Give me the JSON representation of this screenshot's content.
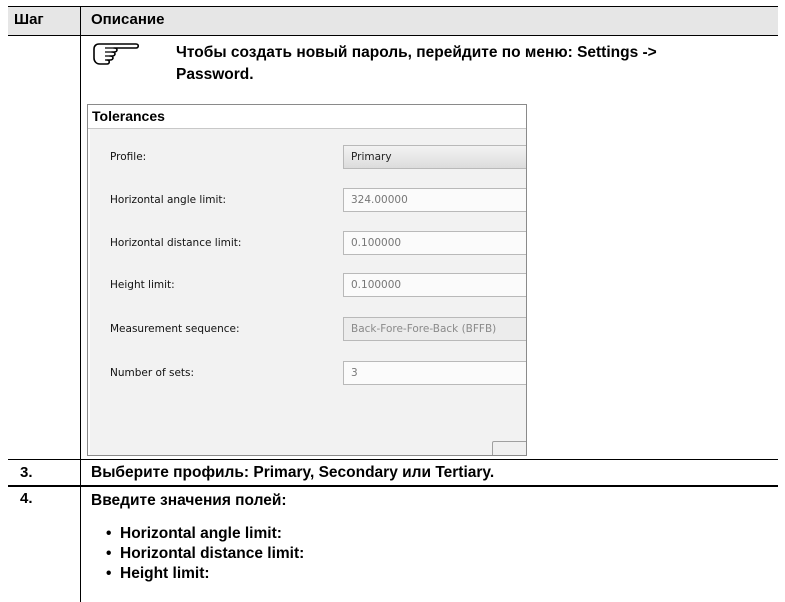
{
  "table": {
    "header_step": "Шаг",
    "header_description": "Описание"
  },
  "note": {
    "icon": "pointing-hand-icon",
    "line1": "Чтобы создать новый пароль, перейдите по меню: Settings ->",
    "line2": "Password."
  },
  "dialog": {
    "title": "Tolerances",
    "fields": [
      {
        "label": "Profile:",
        "value": "Primary"
      },
      {
        "label": "Horizontal angle limit:",
        "value": "324.00000"
      },
      {
        "label": "Horizontal distance limit:",
        "value": "0.100000"
      },
      {
        "label": "Height limit:",
        "value": "0.100000"
      },
      {
        "label": "Measurement sequence:",
        "value": "Back-Fore-Fore-Back (BFFB)"
      },
      {
        "label": "Number of sets:",
        "value": "3"
      }
    ]
  },
  "steps": [
    {
      "number": "3.",
      "text": "Выберите профиль: Primary, Secondary или Tertiary."
    },
    {
      "number": "4.",
      "text": "Введите значения полей:",
      "bullets": [
        "Horizontal angle limit:",
        "Horizontal distance limit:",
        "Height limit:"
      ]
    }
  ]
}
